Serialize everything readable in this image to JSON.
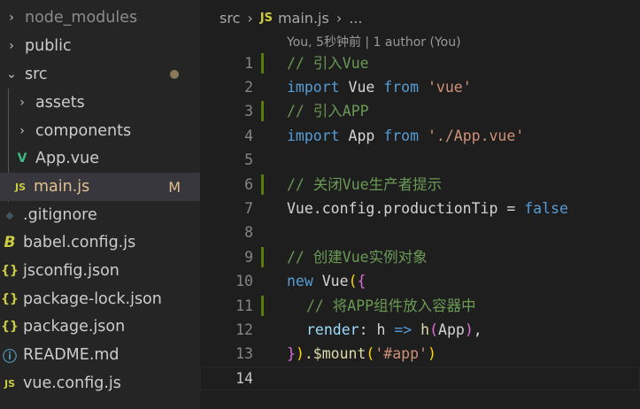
{
  "colors": {
    "sidebar_bg": "#252526",
    "editor_bg": "#1e1e1e",
    "selection": "#37373d",
    "modified": "#e2c08d",
    "untracked_dot": "#8a7a5a",
    "vue_green": "#41b883",
    "js_yellow": "#cbcb41",
    "json_yellow": "#cbcb41",
    "gutter_added": "#587c0c"
  },
  "explorer": {
    "items": [
      {
        "label": "node_modules",
        "icon": "chevron-right-icon",
        "dim": true
      },
      {
        "label": "public",
        "icon": "chevron-right-icon"
      },
      {
        "label": "src",
        "icon": "chevron-down-icon",
        "status": "dot"
      },
      {
        "label": "assets",
        "icon": "chevron-right-icon"
      },
      {
        "label": "components",
        "icon": "chevron-right-icon"
      },
      {
        "label": "App.vue",
        "icon": "vue-icon"
      },
      {
        "label": "main.js",
        "icon": "js-icon",
        "badge": "M"
      },
      {
        "label": ".gitignore",
        "icon": "git-icon"
      },
      {
        "label": "babel.config.js",
        "icon": "babel-icon"
      },
      {
        "label": "jsconfig.json",
        "icon": "json-icon"
      },
      {
        "label": "package-lock.json",
        "icon": "json-icon"
      },
      {
        "label": "package.json",
        "icon": "json-icon"
      },
      {
        "label": "README.md",
        "icon": "info-icon"
      },
      {
        "label": "vue.config.js",
        "icon": "js-icon"
      }
    ],
    "icon_glyphs": {
      "js": "JS",
      "json": "{}",
      "vue": "V",
      "babel": "B",
      "info": "ⓘ",
      "git": "◆"
    }
  },
  "breadcrumb": {
    "folder": "src",
    "file": "main.js",
    "more": "..."
  },
  "codelens": "You, 5秒钟前 | 1 author (You)",
  "code": {
    "line_numbers": [
      "1",
      "2",
      "3",
      "4",
      "5",
      "6",
      "7",
      "8",
      "9",
      "10",
      "11",
      "12",
      "13",
      "14"
    ],
    "current_line": "14",
    "l1": "// 引入Vue",
    "l2": {
      "kw": "import",
      "id": " Vue ",
      "kw2": "from",
      "str": " 'vue'"
    },
    "l3": "// 引入APP",
    "l4": {
      "kw": "import",
      "id": " App ",
      "kw2": "from",
      "str": " './App.vue'"
    },
    "l6": "// 关闭Vue生产者提示",
    "l7": {
      "text": "Vue.config.productionTip = ",
      "kw": "false"
    },
    "l9": "// 创建Vue实例对象",
    "l10": {
      "kw": "new",
      "id": " Vue",
      "p1": "(",
      "b1": "{"
    },
    "l11": "// 将APP组件放入容器中",
    "l12": {
      "prop": "render",
      "mid": ": h ",
      "arrow": "=>",
      "fn": " h",
      "p1": "(",
      "arg": "App",
      "p2": ")",
      "end": ","
    },
    "l13": {
      "b": "}",
      "p": ")",
      "call": ".$mount",
      "p1": "(",
      "str": "'#app'",
      "p2": ")"
    }
  }
}
